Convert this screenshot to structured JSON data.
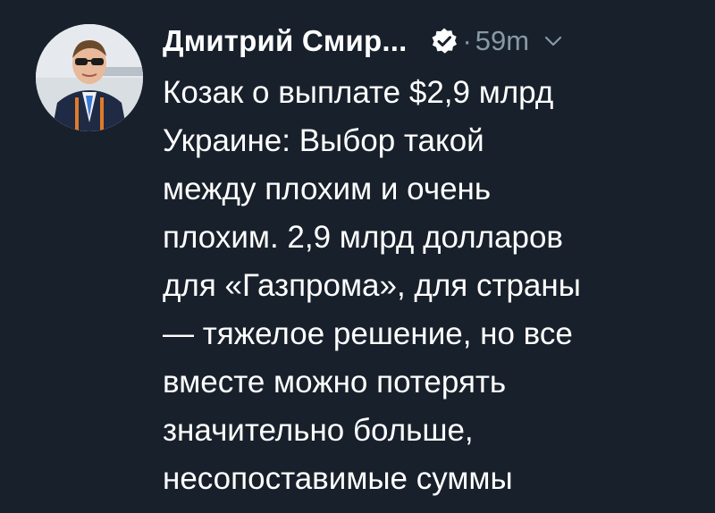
{
  "tweet": {
    "author_name": "Дмитрий Смир...",
    "separator": "·",
    "time": "59m",
    "icons": {
      "avatar": "profile-photo",
      "verified": "verified-badge-icon",
      "menu": "chevron-down-icon"
    },
    "colors": {
      "background": "#18202b",
      "text": "#ffffff",
      "muted": "#8899a6"
    },
    "lines": [
      "Козак о выплате $2,9 млрд",
      "Украине: Выбор такой",
      "между плохим и очень",
      "плохим. 2,9 млрд долларов",
      "для «Газпрома», для страны",
      "— тяжелое решение, но все",
      "вместе можно потерять",
      "значительно больше,",
      "несопоставимые суммы"
    ]
  }
}
